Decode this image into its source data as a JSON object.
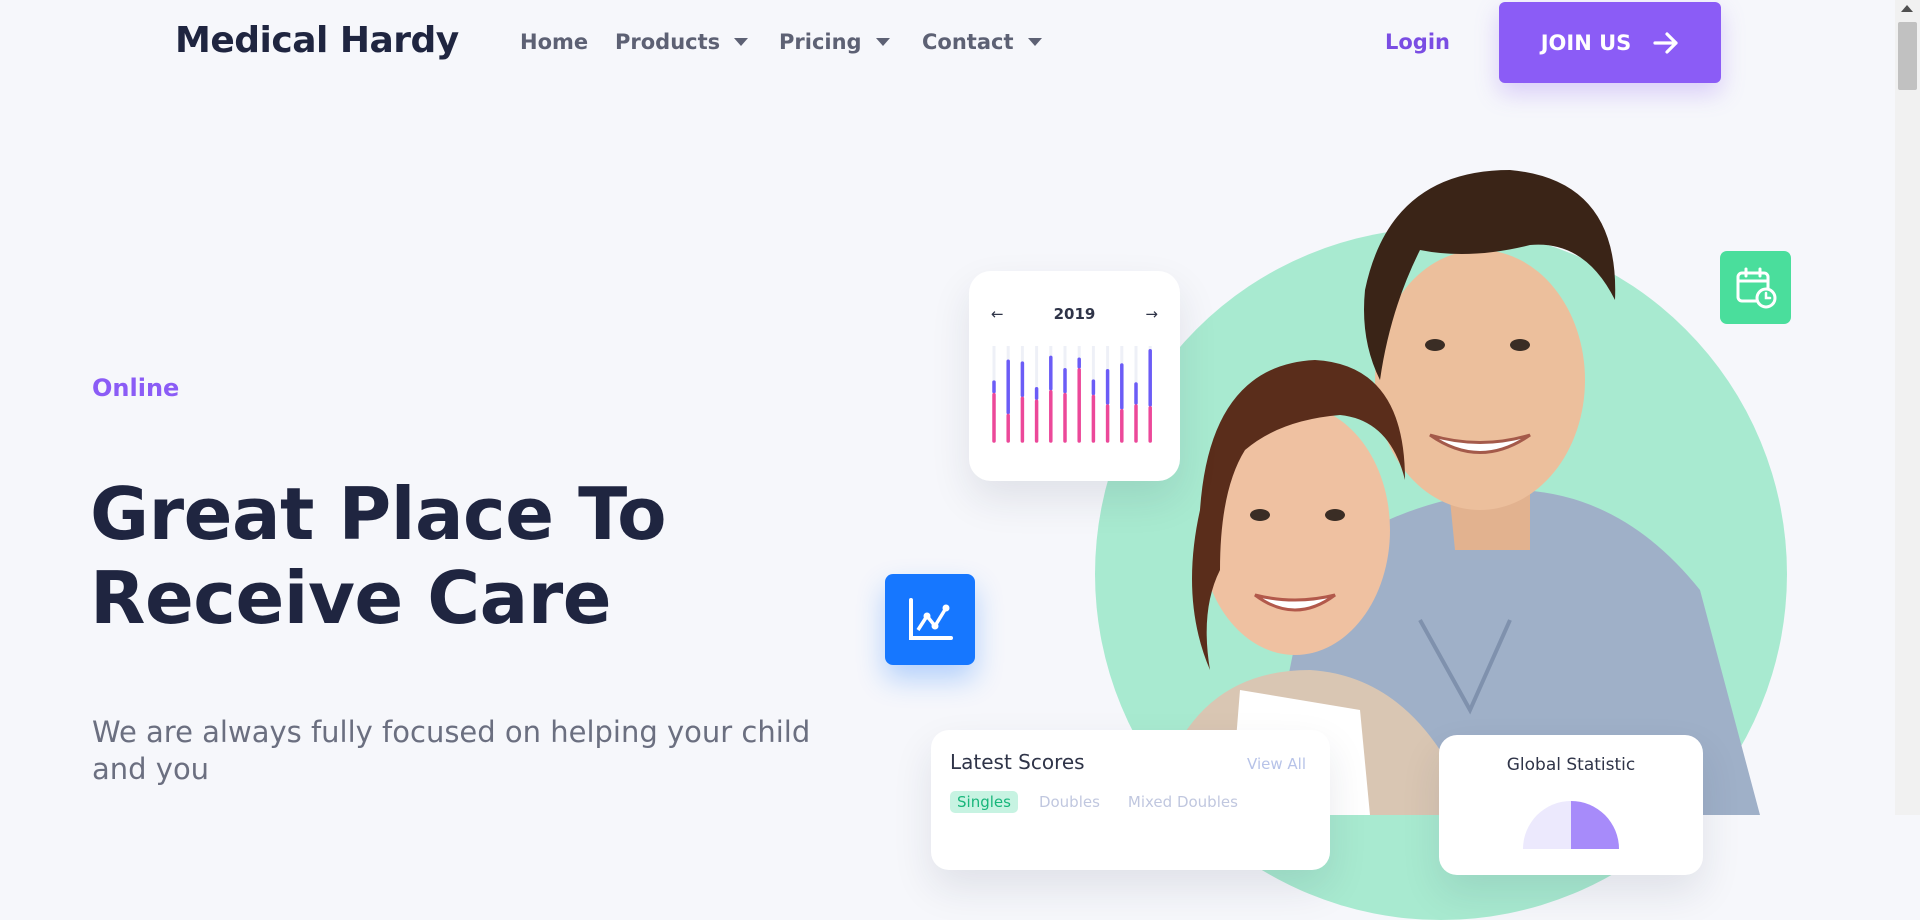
{
  "header": {
    "brand": "Medical Hardy",
    "nav": [
      {
        "label": "Home",
        "has_dropdown": false
      },
      {
        "label": "Products",
        "has_dropdown": true
      },
      {
        "label": "Pricing",
        "has_dropdown": true
      },
      {
        "label": "Contact",
        "has_dropdown": true
      }
    ],
    "login_label": "Login",
    "join_label": "JOIN US",
    "join_icon": "arrow-right-icon"
  },
  "hero": {
    "eyebrow": "Online",
    "headline_line1": "Great Place To",
    "headline_line2": "Receive Care",
    "subtext": "We are always fully focused on helping your child and you"
  },
  "chart_card": {
    "year": "2019",
    "prev_arrow": "←",
    "next_arrow": "→",
    "chart_data": {
      "type": "bar",
      "series": [
        {
          "color": "#6b5cf6",
          "values": [
            0.62,
            0.84,
            0.82,
            0.55,
            0.88,
            0.75,
            0.86,
            0.63,
            0.74,
            0.8,
            0.6,
            0.95
          ]
        },
        {
          "color": "#ec4899",
          "values": [
            0.52,
            0.3,
            0.48,
            0.45,
            0.55,
            0.52,
            0.78,
            0.5,
            0.4,
            0.35,
            0.4,
            0.38
          ]
        }
      ]
    }
  },
  "icons": {
    "blue_tile": "line-chart-icon",
    "green_tile": "calendar-clock-icon"
  },
  "scores_card": {
    "title": "Latest Scores",
    "view_all": "View All",
    "tabs": [
      {
        "label": "Singles",
        "active": true
      },
      {
        "label": "Doubles",
        "active": false
      },
      {
        "label": "Mixed Doubles",
        "active": false
      }
    ]
  },
  "global_card": {
    "title": "Global Statistic"
  },
  "colors": {
    "accent": "#8b5cf6",
    "brand_text": "#1f2540",
    "mint": "#a8ead0",
    "blue": "#1677ff",
    "green": "#4ade9c",
    "pink": "#ec4899"
  }
}
